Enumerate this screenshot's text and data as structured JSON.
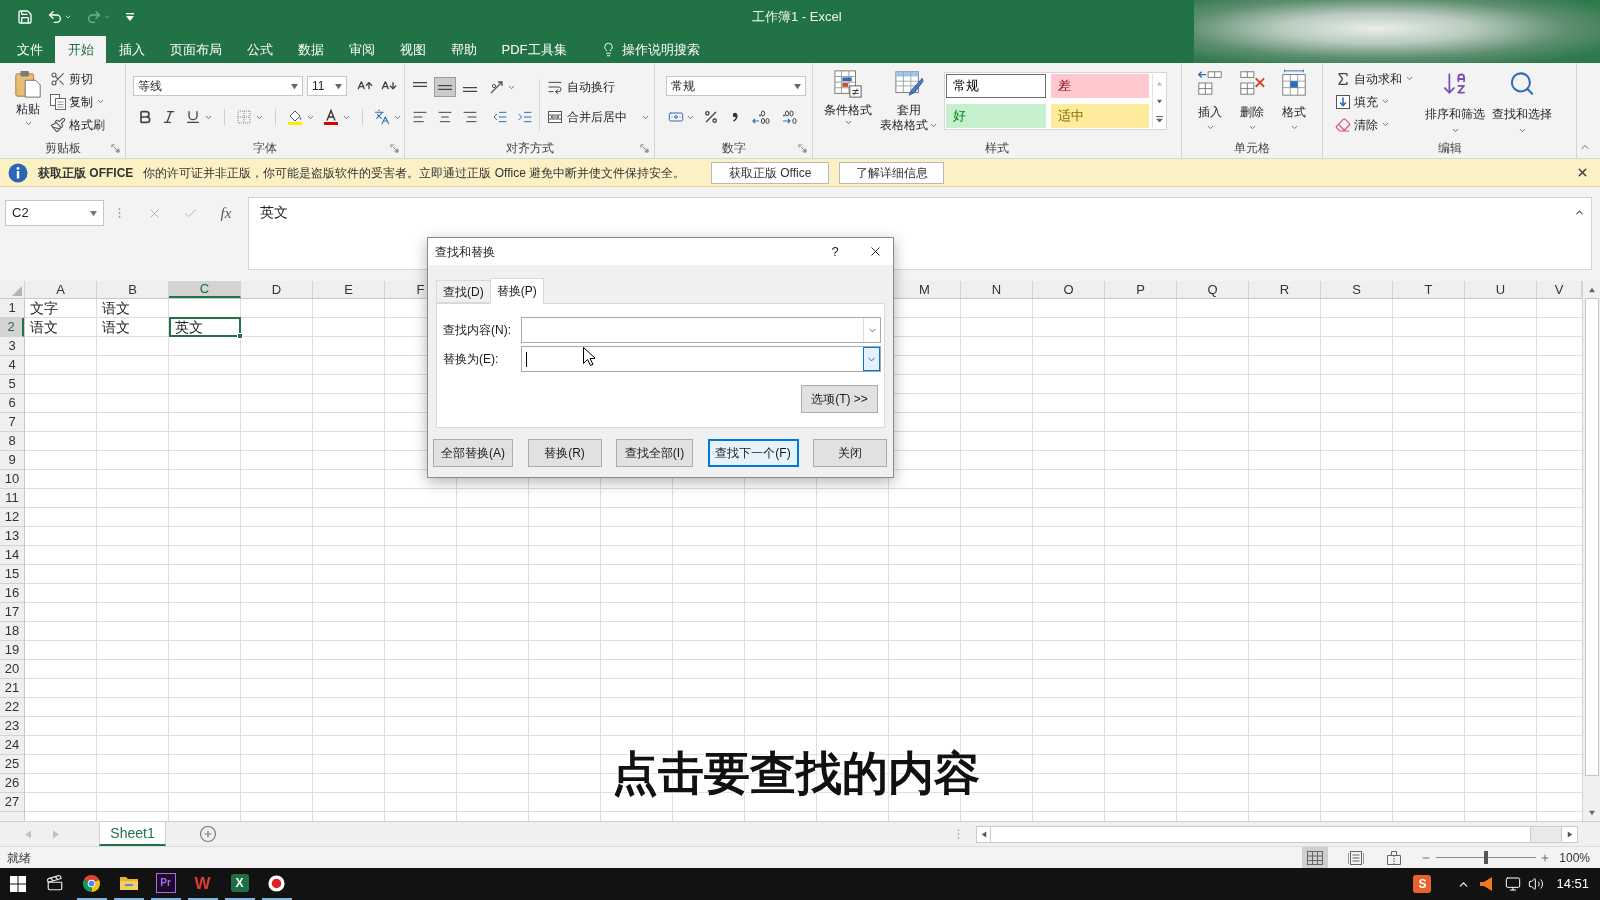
{
  "window": {
    "title": "工作簿1 - Excel"
  },
  "quick_access": [
    {
      "kind": "save",
      "dropdown": false,
      "disabled": false
    },
    {
      "kind": "undo",
      "dropdown": true,
      "disabled": false
    },
    {
      "kind": "redo",
      "dropdown": true,
      "disabled": true
    },
    {
      "kind": "customize",
      "dropdown": false,
      "disabled": false
    }
  ],
  "menu_tabs": [
    {
      "label": "文件",
      "selected": false
    },
    {
      "label": "开始",
      "selected": true
    },
    {
      "label": "插入",
      "selected": false
    },
    {
      "label": "页面布局",
      "selected": false
    },
    {
      "label": "公式",
      "selected": false
    },
    {
      "label": "数据",
      "selected": false
    },
    {
      "label": "审阅",
      "selected": false
    },
    {
      "label": "视图",
      "selected": false
    },
    {
      "label": "帮助",
      "selected": false
    },
    {
      "label": "PDF工具集",
      "selected": false
    }
  ],
  "tell_me": {
    "label": "操作说明搜索"
  },
  "ribbon": {
    "clipboard": {
      "title": "剪贴板",
      "paste": {
        "label": "粘贴"
      },
      "actions": [
        {
          "kind": "cut",
          "label": "剪切",
          "dropdown": false
        },
        {
          "kind": "copy",
          "label": "复制",
          "dropdown": true
        },
        {
          "kind": "format_painter",
          "label": "格式刷",
          "dropdown": false
        }
      ]
    },
    "font": {
      "title": "字体",
      "font_name": "等线",
      "font_size": "11",
      "tools": [
        {
          "kind": "bold",
          "dropdown": false
        },
        {
          "kind": "italic",
          "dropdown": false
        },
        {
          "kind": "underline",
          "dropdown": true
        },
        {
          "kind": "borders",
          "dropdown": true
        },
        {
          "kind": "fill_color",
          "dropdown": true
        },
        {
          "kind": "font_color",
          "dropdown": true
        },
        {
          "kind": "phonetic",
          "dropdown": true
        }
      ]
    },
    "alignment": {
      "title": "对齐方式",
      "vertical": [
        {
          "kind": "top",
          "selected": false
        },
        {
          "kind": "middle",
          "selected": true
        },
        {
          "kind": "bottom",
          "selected": false
        }
      ],
      "horizontal": [
        {
          "kind": "left",
          "selected": false
        },
        {
          "kind": "center",
          "selected": false
        },
        {
          "kind": "right",
          "selected": false
        }
      ],
      "wrap_text": {
        "label": "自动换行"
      },
      "merge": {
        "label": "合并后居中"
      }
    },
    "number": {
      "title": "数字",
      "format": "常规",
      "tools": [
        {
          "kind": "accounting",
          "dropdown": true
        },
        {
          "kind": "percent",
          "dropdown": false
        },
        {
          "kind": "comma",
          "dropdown": false
        },
        {
          "kind": "increase_decimal",
          "dropdown": false
        },
        {
          "kind": "decrease_decimal",
          "dropdown": false
        }
      ]
    },
    "styles": {
      "title": "样式",
      "buttons": [
        {
          "kind": "conditional",
          "lines": [
            "条件格式"
          ]
        },
        {
          "kind": "table",
          "lines": [
            "套用",
            "表格格式"
          ]
        }
      ],
      "gallery": [
        {
          "label": "常规",
          "color": "#ffffff",
          "selected": true
        },
        {
          "label": "差",
          "color": "#ffc7ce",
          "selected": false
        },
        {
          "label": "好",
          "color": "#c6efce",
          "selected": false
        },
        {
          "label": "适中",
          "color": "#ffeb9c",
          "selected": false
        }
      ]
    },
    "cells": {
      "title": "单元格",
      "buttons": [
        {
          "kind": "insert",
          "label": "插入"
        },
        {
          "kind": "delete",
          "label": "删除"
        },
        {
          "kind": "format",
          "label": "格式"
        }
      ]
    },
    "editing": {
      "title": "编辑",
      "small": [
        {
          "kind": "autosum",
          "label": "自动求和",
          "dropdown": true
        },
        {
          "kind": "fill",
          "label": "填充",
          "dropdown": true
        },
        {
          "kind": "clear",
          "label": "清除",
          "dropdown": true
        }
      ],
      "large": [
        {
          "kind": "sort_filter",
          "label": "排序和筛选"
        },
        {
          "kind": "find_select",
          "label": "查找和选择"
        }
      ]
    }
  },
  "notice": {
    "title": "获取正版 OFFICE",
    "message": "你的许可证并非正版，你可能是盗版软件的受害者。立即通过正版 Office 避免中断并使文件保持安全。",
    "buttons": [
      "获取正版 Office",
      "了解详细信息"
    ]
  },
  "formula_bar": {
    "name_box": "C2",
    "function_label": "fx",
    "content": "英文"
  },
  "sheet": {
    "columns_left": [
      {
        "label": "A",
        "selected": false
      },
      {
        "label": "B",
        "selected": false
      },
      {
        "label": "C",
        "selected": true
      },
      {
        "label": "D",
        "selected": false
      },
      {
        "label": "E",
        "selected": false
      },
      {
        "label": "F",
        "selected": false
      }
    ],
    "columns_right": [
      {
        "label": "M",
        "selected": false
      },
      {
        "label": "N",
        "selected": false
      },
      {
        "label": "O",
        "selected": false
      },
      {
        "label": "P",
        "selected": false
      },
      {
        "label": "Q",
        "selected": false
      },
      {
        "label": "R",
        "selected": false
      },
      {
        "label": "S",
        "selected": false
      },
      {
        "label": "T",
        "selected": false
      },
      {
        "label": "U",
        "selected": false
      },
      {
        "label": "V",
        "selected": false
      }
    ],
    "rows": [
      {
        "label": "1",
        "selected": false,
        "cells": [
          {
            "text": "文字",
            "selected": false
          },
          {
            "text": "语文",
            "selected": false
          }
        ]
      },
      {
        "label": "2",
        "selected": true,
        "cells": [
          {
            "text": "语文",
            "selected": false
          },
          {
            "text": "语文",
            "selected": false
          },
          {
            "text": "英文",
            "selected": true
          }
        ]
      },
      {
        "label": "3",
        "selected": false
      },
      {
        "label": "4",
        "selected": false
      },
      {
        "label": "5",
        "selected": false
      },
      {
        "label": "6",
        "selected": false
      },
      {
        "label": "7",
        "selected": false
      },
      {
        "label": "8",
        "selected": false
      },
      {
        "label": "9",
        "selected": false
      },
      {
        "label": "10",
        "selected": false
      },
      {
        "label": "11",
        "selected": false
      },
      {
        "label": "12",
        "selected": false
      },
      {
        "label": "13",
        "selected": false
      },
      {
        "label": "14",
        "selected": false
      },
      {
        "label": "15",
        "selected": false
      },
      {
        "label": "16",
        "selected": false
      },
      {
        "label": "17",
        "selected": false
      },
      {
        "label": "18",
        "selected": false
      },
      {
        "label": "19",
        "selected": false
      },
      {
        "label": "20",
        "selected": false
      },
      {
        "label": "21",
        "selected": false
      },
      {
        "label": "22",
        "selected": false
      },
      {
        "label": "23",
        "selected": false
      },
      {
        "label": "24",
        "selected": false
      },
      {
        "label": "25",
        "selected": false
      },
      {
        "label": "26",
        "selected": false
      },
      {
        "label": "27",
        "selected": false
      }
    ]
  },
  "sheet_tabs": [
    {
      "label": "Sheet1",
      "selected": true
    }
  ],
  "status_bar": {
    "status": "就绪",
    "views": [
      {
        "kind": "normal",
        "selected": true
      },
      {
        "kind": "page_layout",
        "selected": false
      },
      {
        "kind": "page_break",
        "selected": false
      }
    ],
    "zoom": {
      "level": 0.5,
      "reading": "100%"
    }
  },
  "taskbar": {
    "apps": [
      {
        "kind": "media",
        "running": false
      },
      {
        "kind": "browser",
        "running": true
      },
      {
        "kind": "folder",
        "running": true
      },
      {
        "kind": "outlined_tile",
        "glyph": "Pr",
        "color": "#a46ee8",
        "running": true
      },
      {
        "kind": "letter",
        "glyph": "W",
        "color": "#e23b2e",
        "running": true
      },
      {
        "kind": "filled_tile",
        "glyph": "X",
        "color": "#1d7044",
        "running": true
      },
      {
        "kind": "recorder",
        "running": true
      }
    ],
    "tray": [
      {
        "kind": "filled_tile",
        "glyph": "S",
        "color": "#e8622c"
      },
      {
        "kind": "chevron"
      },
      {
        "kind": "speaker_alert"
      },
      {
        "kind": "network"
      },
      {
        "kind": "volume"
      }
    ],
    "time": "14:51"
  },
  "dialog": {
    "title": "查找和替换",
    "help": "?",
    "tabs": [
      {
        "label": "查找(D)",
        "selected": false
      },
      {
        "label": "替换(P)",
        "selected": true
      }
    ],
    "fields": [
      {
        "label": "查找内容(N):",
        "focused": false
      },
      {
        "label": "替换为(E):",
        "focused": true
      }
    ],
    "options_button": "选项(T) >>",
    "buttons": [
      {
        "label": "全部替换(A)",
        "default": false
      },
      {
        "label": "替换(R)",
        "default": false
      },
      {
        "label": "查找全部(I)",
        "default": false
      },
      {
        "label": "查找下一个(F)",
        "default": true
      },
      {
        "label": "关闭",
        "default": false
      }
    ]
  },
  "caption": "点击要查找的内容"
}
